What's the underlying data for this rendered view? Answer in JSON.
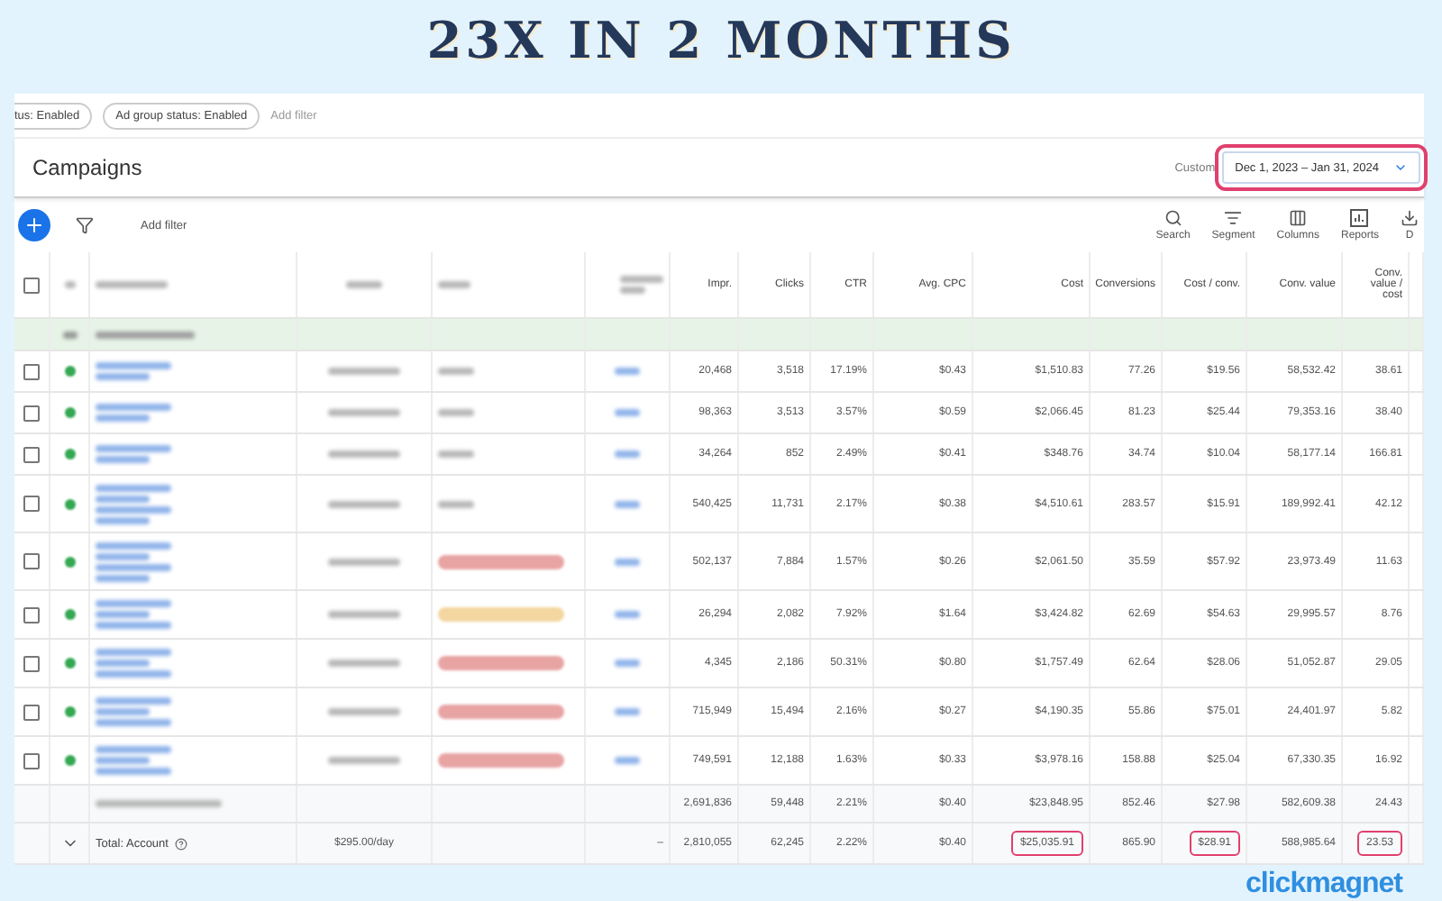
{
  "headline": "23X IN 2 MONTHS",
  "filter_bar": {
    "chips": [
      "tus: Enabled",
      "Ad group status: Enabled"
    ],
    "add_filter": "Add filter"
  },
  "header": {
    "title": "Campaigns",
    "date_label": "Custom",
    "date_range": "Dec 1, 2023 – Jan 31, 2024",
    "date_highlighted": true
  },
  "toolbar": {
    "add_filter": "Add filter",
    "tools": [
      {
        "kind": "search",
        "label": "Search"
      },
      {
        "kind": "segment",
        "label": "Segment"
      },
      {
        "kind": "columns",
        "label": "Columns"
      },
      {
        "kind": "reports",
        "label": "Reports"
      },
      {
        "kind": "cut",
        "label": "D"
      }
    ]
  },
  "table": {
    "columns": [
      "Impr.",
      "Clicks",
      "CTR",
      "Avg. CPC",
      "Cost",
      "Conversions",
      "Cost / conv.",
      "Conv. value",
      "Conv. value / cost"
    ],
    "header_checked": false,
    "rows": [
      {
        "kind": "short",
        "checked": false,
        "cells": [
          "20,468",
          "3,518",
          "17.19%",
          "$0.43",
          "$1,510.83",
          "77.26",
          "$19.56",
          "58,532.42",
          "38.61"
        ]
      },
      {
        "kind": "short",
        "checked": false,
        "cells": [
          "98,363",
          "3,513",
          "3.57%",
          "$0.59",
          "$2,066.45",
          "81.23",
          "$25.44",
          "79,353.16",
          "38.40"
        ]
      },
      {
        "kind": "short",
        "checked": false,
        "cells": [
          "34,264",
          "852",
          "2.49%",
          "$0.41",
          "$348.76",
          "34.74",
          "$10.04",
          "58,177.14",
          "166.81"
        ]
      },
      {
        "kind": "tall",
        "checked": false,
        "cells": [
          "540,425",
          "11,731",
          "2.17%",
          "$0.38",
          "$4,510.61",
          "283.57",
          "$15.91",
          "189,992.41",
          "42.12"
        ]
      },
      {
        "kind": "tall",
        "checked": false,
        "color": "#e8a3a3",
        "cells": [
          "502,137",
          "7,884",
          "1.57%",
          "$0.26",
          "$2,061.50",
          "35.59",
          "$57.92",
          "23,973.49",
          "11.63"
        ]
      },
      {
        "kind": "medium",
        "checked": false,
        "color": "#f3d6a0",
        "cells": [
          "26,294",
          "2,082",
          "7.92%",
          "$1.64",
          "$3,424.82",
          "62.69",
          "$54.63",
          "29,995.57",
          "8.76"
        ]
      },
      {
        "kind": "medium",
        "checked": false,
        "color": "#e8a3a3",
        "cells": [
          "4,345",
          "2,186",
          "50.31%",
          "$0.80",
          "$1,757.49",
          "62.64",
          "$28.06",
          "51,052.87",
          "29.05"
        ]
      },
      {
        "kind": "medium",
        "checked": false,
        "color": "#e8a3a3",
        "cells": [
          "715,949",
          "15,494",
          "2.16%",
          "$0.27",
          "$4,190.35",
          "55.86",
          "$75.01",
          "24,401.97",
          "5.82"
        ]
      },
      {
        "kind": "medium",
        "checked": false,
        "color": "#e8a3a3",
        "cells": [
          "749,591",
          "12,188",
          "1.63%",
          "$0.33",
          "$3,978.16",
          "158.88",
          "$25.04",
          "67,330.35",
          "16.92"
        ]
      }
    ],
    "subtotal": [
      "2,691,836",
      "59,448",
      "2.21%",
      "$0.40",
      "$23,848.95",
      "852.46",
      "$27.98",
      "582,609.38",
      "24.43"
    ],
    "total": {
      "label": "Total: Account",
      "budget": "$295.00/day",
      "dash": "–",
      "cells": [
        {
          "text": "2,810,055",
          "highlighted": false
        },
        {
          "text": "62,245",
          "highlighted": false
        },
        {
          "text": "2.22%",
          "highlighted": false
        },
        {
          "text": "$0.40",
          "highlighted": false
        },
        {
          "text": "$25,035.91",
          "highlighted": true
        },
        {
          "text": "865.90",
          "highlighted": false
        },
        {
          "text": "$28.91",
          "highlighted": true
        },
        {
          "text": "588,985.64",
          "highlighted": false
        },
        {
          "text": "23.53",
          "highlighted": true
        }
      ]
    }
  },
  "brand": "clickmagnet"
}
